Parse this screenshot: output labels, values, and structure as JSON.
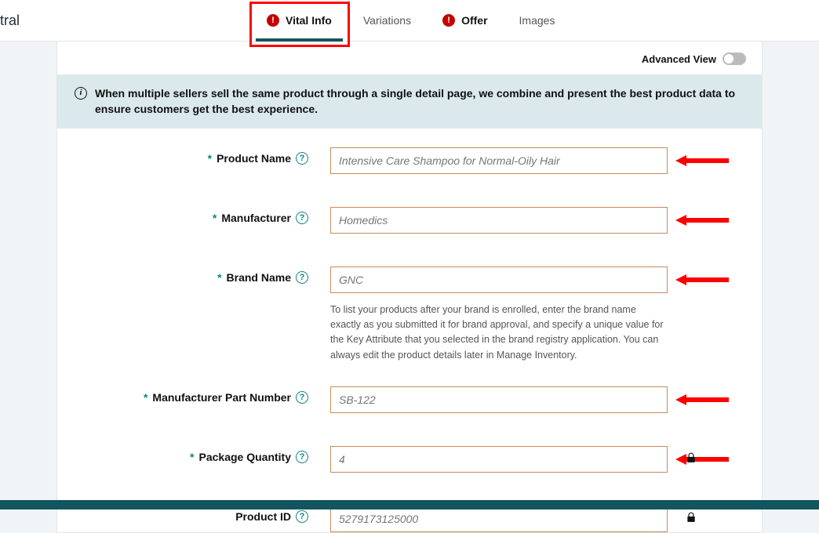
{
  "header": {
    "logo_fragment": "ntral"
  },
  "tabs": {
    "vital_info": "Vital Info",
    "variations": "Variations",
    "offer": "Offer",
    "images": "Images"
  },
  "advanced": {
    "label": "Advanced View"
  },
  "info_banner": {
    "text": "When multiple sellers sell the same product through a single detail page, we combine and present the best product data to ensure customers get the best experience."
  },
  "fields": {
    "product_name": {
      "label": "Product Name",
      "placeholder": "Intensive Care Shampoo for Normal-Oily Hair"
    },
    "manufacturer": {
      "label": "Manufacturer",
      "placeholder": "Homedics"
    },
    "brand_name": {
      "label": "Brand Name",
      "placeholder": "GNC",
      "helper": "To list your products after your brand is enrolled, enter the brand name exactly as you submitted it for brand approval, and specify a unique value for the Key Attribute that you selected in the brand registry application. You can always edit the product details later in Manage Inventory."
    },
    "mpn": {
      "label": "Manufacturer Part Number",
      "placeholder": "SB-122"
    },
    "package_qty": {
      "label": "Package Quantity",
      "placeholder": "4"
    },
    "product_id": {
      "label": "Product ID",
      "placeholder": "5279173125000"
    }
  }
}
